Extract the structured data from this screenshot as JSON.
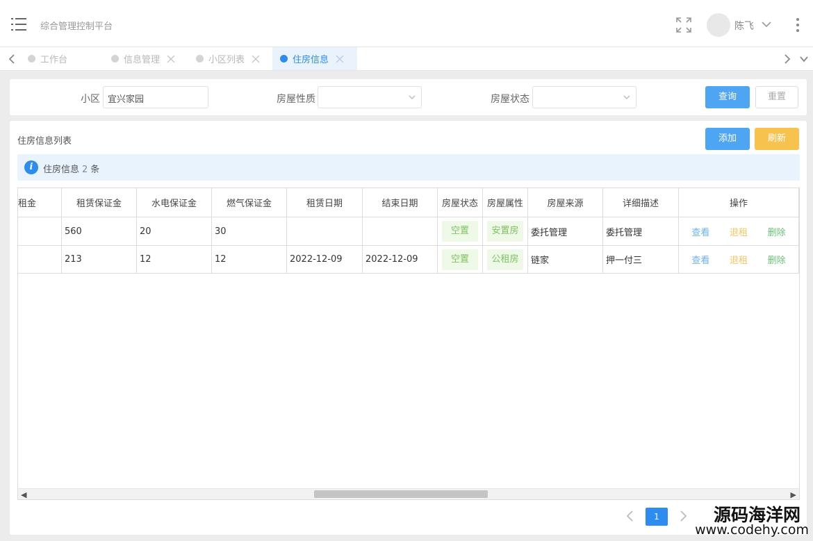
{
  "header": {
    "app_title": "综合管理控制平台",
    "user_name": "陈飞"
  },
  "tabs": [
    {
      "label": "工作台",
      "active": false
    },
    {
      "label": "信息管理",
      "active": false
    },
    {
      "label": "小区列表",
      "active": false
    },
    {
      "label": "住房信息",
      "active": true
    }
  ],
  "search": {
    "community_label": "小区",
    "community_value": "宜兴家园",
    "nature_label": "房屋性质",
    "nature_value": "",
    "status_label": "房屋状态",
    "status_value": "",
    "query_label": "查询",
    "reset_label": "重置"
  },
  "list": {
    "title": "住房信息列表",
    "add_label": "添加",
    "refresh_label": "刷新",
    "info_prefix": "住房信息",
    "info_count": "2",
    "info_suffix": "条"
  },
  "table": {
    "columns": [
      "租金",
      "租赁保证金",
      "水电保证金",
      "燃气保证金",
      "租赁日期",
      "结束日期",
      "房屋状态",
      "房屋属性",
      "房屋来源",
      "详细描述",
      "操作"
    ],
    "column_truncated_label": "租金",
    "rows": [
      {
        "rent": "",
        "rent_deposit": "560",
        "utility_deposit": "20",
        "gas_deposit": "30",
        "lease_date": "",
        "end_date": "",
        "status": "空置",
        "attribute": "安置房",
        "source": "委托管理",
        "description": "委托管理"
      },
      {
        "rent": "",
        "rent_deposit": "213",
        "utility_deposit": "12",
        "gas_deposit": "12",
        "lease_date": "2022-12-09",
        "end_date": "2022-12-09",
        "status": "空置",
        "attribute": "公租房",
        "source": "链家",
        "description": "押一付三"
      }
    ],
    "actions": {
      "view": "查看",
      "rent": "退租",
      "delete": "删除"
    }
  },
  "pagination": {
    "current_page": "1"
  },
  "watermark": {
    "name": "源码海洋网",
    "url": "www.codehy.com"
  },
  "colors": {
    "primary": "#2d8cf0",
    "warning": "#f8c24f",
    "tag_bg": "#eef9e8",
    "tag_text": "#7ec260"
  }
}
